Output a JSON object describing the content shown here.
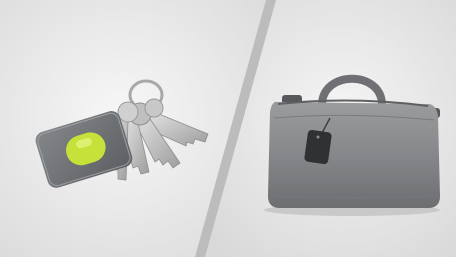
{
  "scene": {
    "left_panel": {
      "subject": "keychain-with-tracker-tag",
      "background_color": "#e9e9e9",
      "tag_color": "#6d7073",
      "accent_color": "#c6e23a"
    },
    "right_panel": {
      "subject": "grey-laptop-bag-with-tracker-tag",
      "background_color": "#e6e6e6",
      "bag_color": "#8a8b8d",
      "tag_color": "#2f3133"
    },
    "divider_color": "#b9b9b9"
  }
}
